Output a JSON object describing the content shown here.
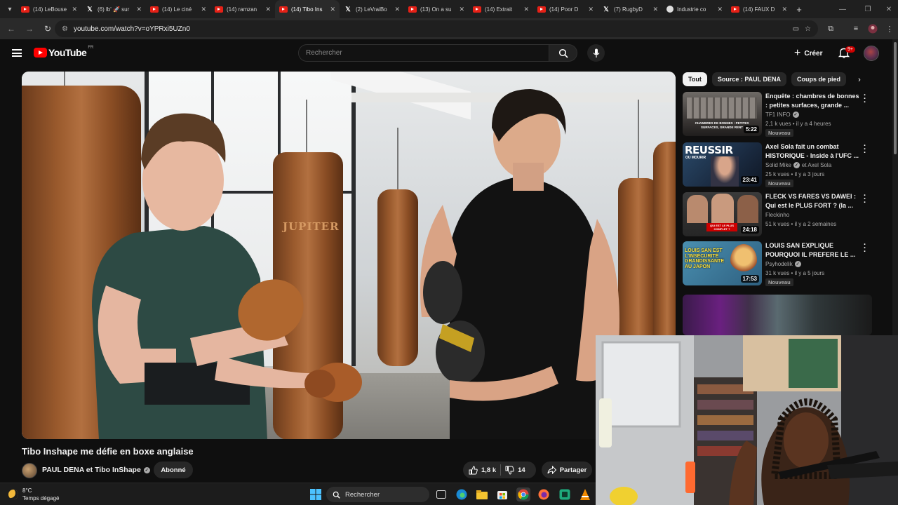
{
  "browser": {
    "tabs": [
      {
        "title": "(14) LeBouse",
        "favicon": "youtube-favicon"
      },
      {
        "title": "(6) lb' 🚀 sur",
        "favicon": "x-favicon"
      },
      {
        "title": "(14) Le ciné",
        "favicon": "youtube-favicon"
      },
      {
        "title": "(14) ramzan",
        "favicon": "youtube-favicon"
      },
      {
        "title": "(14) Tibo Ins",
        "favicon": "youtube-favicon",
        "active": true
      },
      {
        "title": "(2) LeVraiBo",
        "favicon": "x-favicon"
      },
      {
        "title": "(13) On a su",
        "favicon": "youtube-favicon"
      },
      {
        "title": "(14) Extrait",
        "favicon": "youtube-favicon"
      },
      {
        "title": "(14) Poor D",
        "favicon": "youtube-favicon"
      },
      {
        "title": "(7) RugbyD",
        "favicon": "x-favicon"
      },
      {
        "title": "Industrie co",
        "favicon": "generic-favicon"
      },
      {
        "title": "(14) FAUX D",
        "favicon": "youtube-favicon"
      }
    ],
    "url": "youtube.com/watch?v=oYPRxi5UZn0"
  },
  "masthead": {
    "logo_text": "YouTube",
    "region": "FR",
    "search_placeholder": "Rechercher",
    "create_label": "Créer",
    "notification_count": "9+"
  },
  "video": {
    "overlay_text": "JUPITER",
    "title": "Tibo Inshape me défie en boxe anglaise",
    "channel": "PAUL DENA et Tibo InShape",
    "subscribe_label": "Abonné",
    "likes": "1,8 k",
    "dislikes": "14",
    "share_label": "Partager"
  },
  "sidebar": {
    "chips": [
      "Tout",
      "Source : PAUL DENA",
      "Coups de pied"
    ],
    "recommendations": [
      {
        "title": "Enquête : chambres de bonnes : petites surfaces, grande ...",
        "channel": "TF1 INFO",
        "verified": true,
        "meta": "2,1 k vues • il y a 4 heures",
        "badge": "Nouveau",
        "duration": "5:22",
        "thumb_caption": "CHAMBRES DE BONNES : PETITES SURFACES, GRANDE RENT"
      },
      {
        "title": "Axel Sola fait un combat HISTORIQUE - Inside à l'UFC ...",
        "channel": "Solid Mike",
        "channel_extra": "et Axel Sola",
        "verified": true,
        "meta": "25 k vues • il y a 3 jours",
        "badge": "Nouveau",
        "duration": "23:41",
        "thumb_caption": "REUSSIR OU MOURIR"
      },
      {
        "title": "FLECK VS FARES VS DAWEI : Qui est le PLUS FORT ? (la ...",
        "channel": "Fleckinho",
        "verified": false,
        "meta": "51 k vues • il y a 2 semaines",
        "badge": "",
        "duration": "24:18",
        "thumb_caption": "QUI EST LE PLUS COMPLET ?"
      },
      {
        "title": "LOUIS SAN EXPLIQUE POURQUOI IL PREFERE LE ...",
        "channel": "Psyhodelik",
        "verified": true,
        "meta": "31 k vues • il y a 5 jours",
        "badge": "Nouveau",
        "duration": "17:53",
        "thumb_caption": "LOUIS SAN EST L'INSÉCURITÉ GRANDISSANTE AU JAPON"
      }
    ]
  },
  "taskbar": {
    "temperature": "8°C",
    "weather": "Temps dégagé",
    "search_label": "Rechercher"
  },
  "colors": {
    "yt_red": "#ff0000",
    "page_bg": "#0f0f0f",
    "chip_bg": "#272727",
    "text_primary": "#f1f1f1",
    "text_secondary": "#aaaaaa"
  }
}
